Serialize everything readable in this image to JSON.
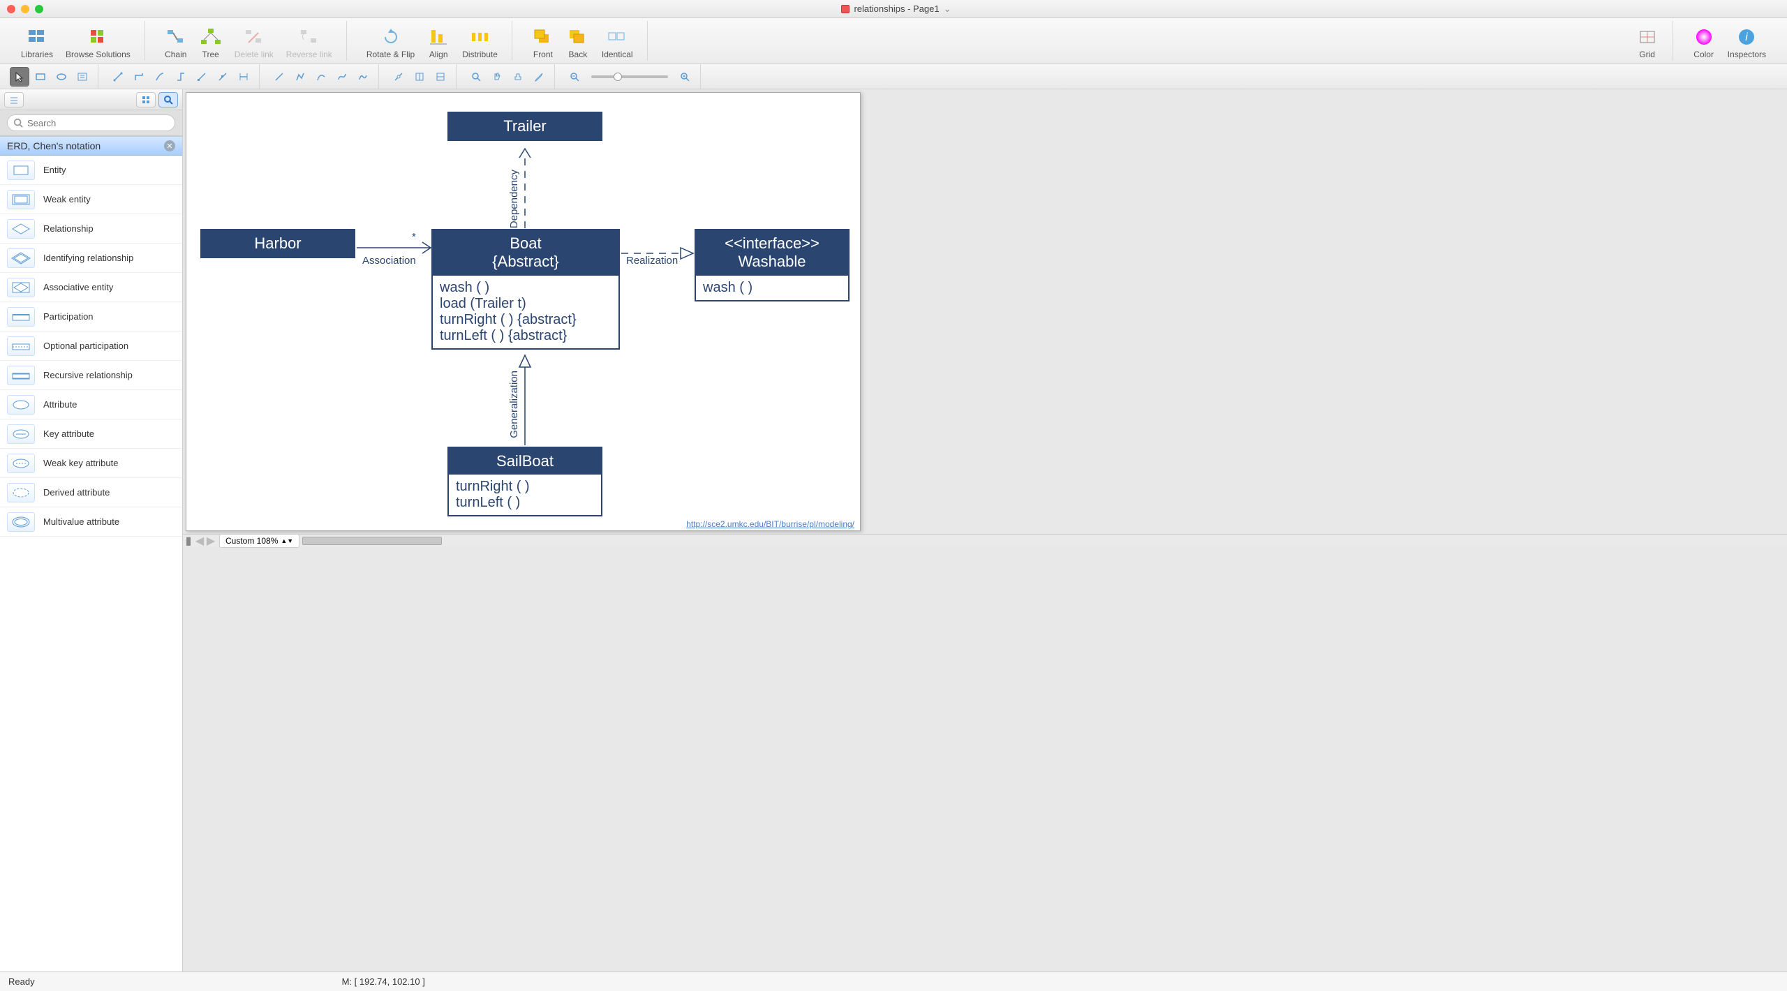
{
  "window": {
    "title": "relationships - Page1"
  },
  "toolbar": {
    "libraries": "Libraries",
    "browse": "Browse Solutions",
    "chain": "Chain",
    "tree": "Tree",
    "delete_link": "Delete link",
    "reverse_link": "Reverse link",
    "rotate_flip": "Rotate & Flip",
    "align": "Align",
    "distribute": "Distribute",
    "front": "Front",
    "back": "Back",
    "identical": "Identical",
    "grid": "Grid",
    "color": "Color",
    "inspectors": "Inspectors"
  },
  "search": {
    "placeholder": "Search"
  },
  "panel": {
    "title": "ERD, Chen's notation"
  },
  "shapes": [
    "Entity",
    "Weak entity",
    "Relationship",
    "Identifying relationship",
    "Associative entity",
    "Participation",
    "Optional participation",
    "Recursive relationship",
    "Attribute",
    "Key attribute",
    "Weak key attribute",
    "Derived attribute",
    "Multivalue attribute"
  ],
  "diagram": {
    "trailer": {
      "title": "Trailer"
    },
    "harbor": {
      "title": "Harbor"
    },
    "boat": {
      "title": "Boat",
      "subtitle": "{Abstract}",
      "ops": [
        "wash ( )",
        "load (Trailer t)",
        "turnRight ( ) {abstract}",
        "turnLeft ( ) {abstract}"
      ]
    },
    "washable": {
      "title1": "<<interface>>",
      "title2": "Washable",
      "ops": [
        "wash ( )"
      ]
    },
    "sailboat": {
      "title": "SailBoat",
      "ops": [
        "turnRight ( )",
        "turnLeft ( )"
      ]
    },
    "labels": {
      "dependency": "Dependency",
      "association": "Association",
      "star": "*",
      "realization": "Realization",
      "generalization": "Generalization"
    },
    "attribution": "http://sce2.umkc.edu/BIT/burrise/pl/modeling/"
  },
  "bottombar": {
    "zoom_label": "Custom 108%"
  },
  "status": {
    "ready": "Ready",
    "mouse": "M: [ 192.74, 102.10 ]"
  }
}
